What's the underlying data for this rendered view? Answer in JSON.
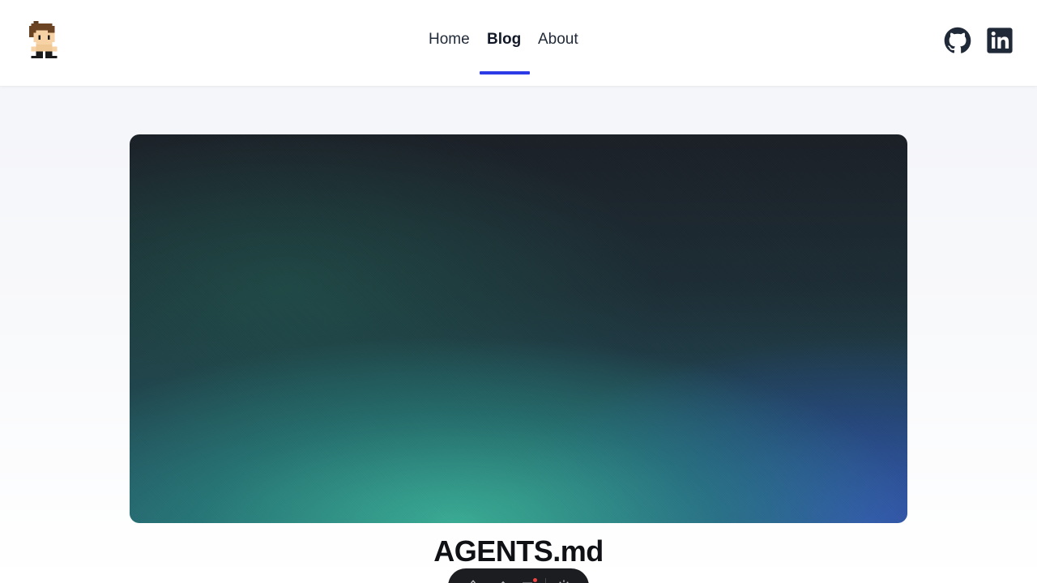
{
  "header": {
    "nav": [
      {
        "label": "Home"
      },
      {
        "label": "Blog",
        "active": true
      },
      {
        "label": "About"
      }
    ],
    "social": [
      {
        "icon": "github-icon"
      },
      {
        "icon": "linkedin-icon"
      }
    ],
    "avatar_icon": "pixel-avatar-icon"
  },
  "hero": {
    "image": "gradient-cover-image"
  },
  "post": {
    "title": "AGENTS.md"
  },
  "toolbar": {
    "icons": [
      "inspect-icon",
      "annotate-icon",
      "list-icon",
      "settings-icon"
    ]
  },
  "colors": {
    "accent": "#2d3be6",
    "text": "#1f2937",
    "title": "#0f1115",
    "toolbar_bg": "#1c1d21"
  }
}
